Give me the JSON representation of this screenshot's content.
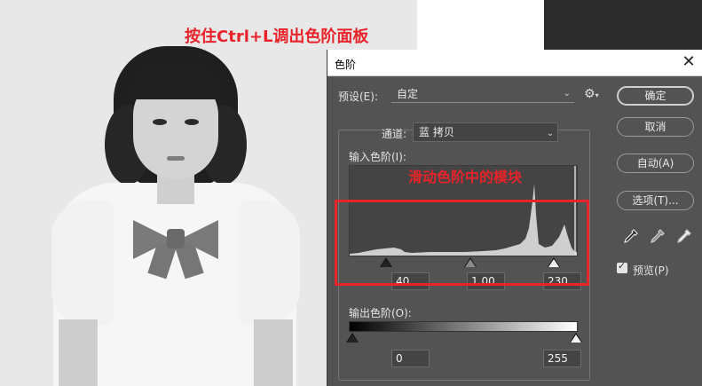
{
  "annotations": {
    "top_hint": "按住Ctrl+L调出色阶面板",
    "slider_hint": "滑动色阶中的模块",
    "color": "#e8232a"
  },
  "dialog": {
    "title": "色阶",
    "close_icon": "close-icon",
    "preset": {
      "label": "预设(E):",
      "value": "自定",
      "options_icon": "gear-icon"
    },
    "channel": {
      "label": "通道:",
      "value": "蓝 拷贝"
    },
    "input_levels": {
      "label": "输入色阶(I):",
      "black": "40",
      "gamma": "1.00",
      "white": "230"
    },
    "output_levels": {
      "label": "输出色阶(O):",
      "black": "0",
      "white": "255"
    },
    "buttons": {
      "ok": "确定",
      "cancel": "取消",
      "auto": "自动(A)",
      "options": "选项(T)..."
    },
    "eyedroppers": [
      "black-eyedropper-icon",
      "gray-eyedropper-icon",
      "white-eyedropper-icon"
    ],
    "preview": {
      "label": "预览(P)",
      "checked": true
    }
  }
}
